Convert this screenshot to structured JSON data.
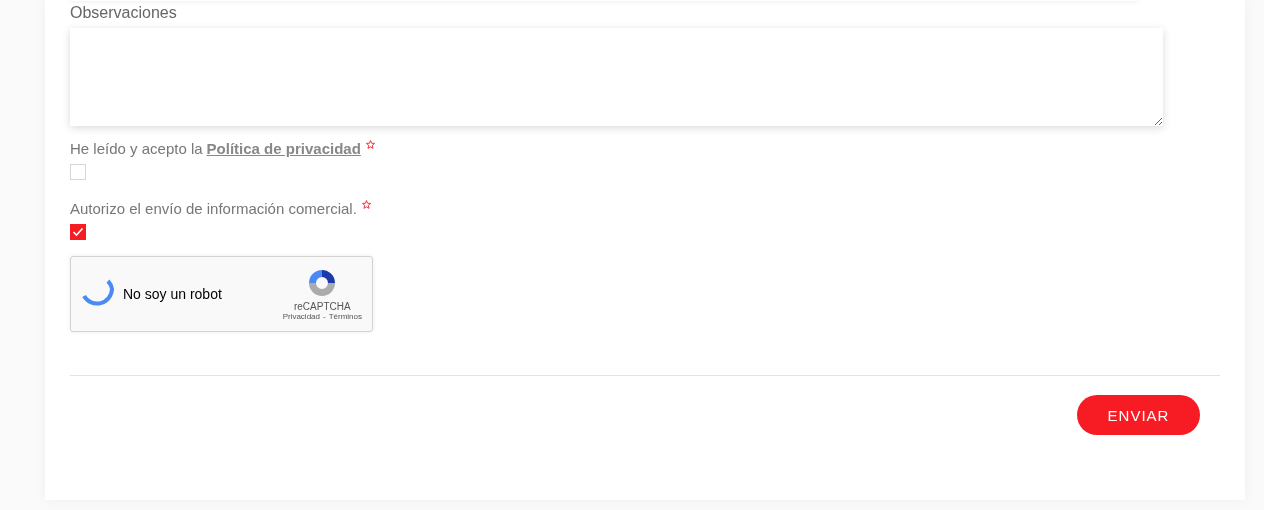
{
  "observations": {
    "label": "Observaciones"
  },
  "consents": [
    {
      "text": "He leído y acepto la",
      "link": "Política de privacidad",
      "required": true,
      "checked": false
    },
    {
      "text": "Autorizo el envío de información comercial.",
      "required": true,
      "checked": true
    }
  ],
  "captcha": {
    "label": "No soy un robot",
    "brand": "reCAPTCHA",
    "privacy": "Privacidad",
    "separator": "-",
    "terms": "Términos"
  },
  "submit": {
    "label": "ENVIAR"
  }
}
